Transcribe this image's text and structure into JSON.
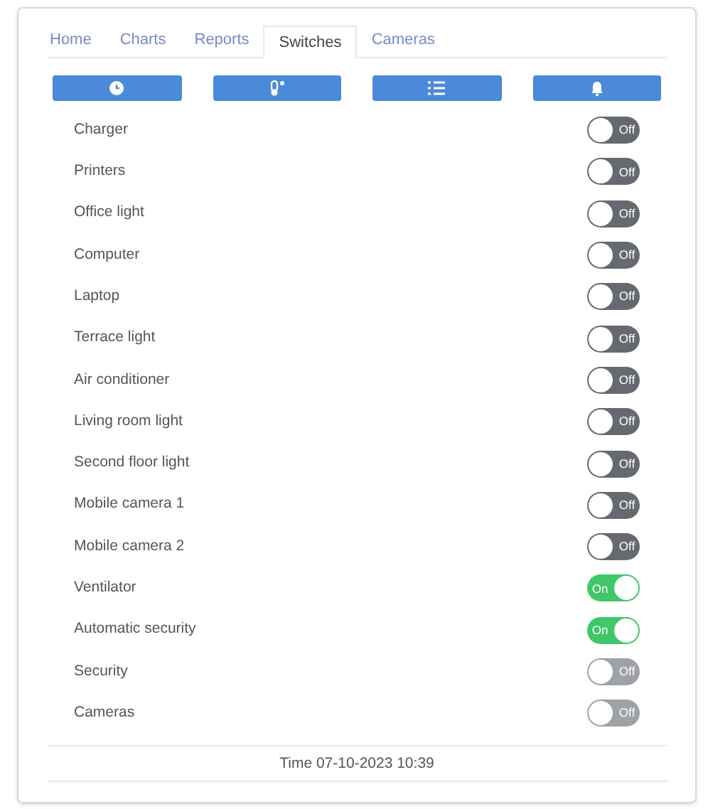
{
  "tabs": [
    {
      "label": "Home",
      "selected": false
    },
    {
      "label": "Charts",
      "selected": false
    },
    {
      "label": "Reports",
      "selected": false
    },
    {
      "label": "Switches",
      "selected": true
    },
    {
      "label": "Cameras",
      "selected": false
    }
  ],
  "toolbar": [
    {
      "kind": "clock"
    },
    {
      "kind": "thermometer"
    },
    {
      "kind": "list"
    },
    {
      "kind": "bell"
    }
  ],
  "switches": [
    {
      "name": "Charger",
      "on": false,
      "disabled": false,
      "state_label": "Off"
    },
    {
      "name": "Printers",
      "on": false,
      "disabled": false,
      "state_label": "Off"
    },
    {
      "name": "Office light",
      "on": false,
      "disabled": false,
      "state_label": "Off"
    },
    {
      "name": "Computer",
      "on": false,
      "disabled": false,
      "state_label": "Off"
    },
    {
      "name": "Laptop",
      "on": false,
      "disabled": false,
      "state_label": "Off"
    },
    {
      "name": "Terrace light",
      "on": false,
      "disabled": false,
      "state_label": "Off"
    },
    {
      "name": "Air conditioner",
      "on": false,
      "disabled": false,
      "state_label": "Off"
    },
    {
      "name": "Living room light",
      "on": false,
      "disabled": false,
      "state_label": "Off"
    },
    {
      "name": "Second floor light",
      "on": false,
      "disabled": false,
      "state_label": "Off"
    },
    {
      "name": "Mobile camera 1",
      "on": false,
      "disabled": false,
      "state_label": "Off"
    },
    {
      "name": "Mobile camera 2",
      "on": false,
      "disabled": false,
      "state_label": "Off"
    },
    {
      "name": "Ventilator",
      "on": true,
      "disabled": false,
      "state_label": "On"
    },
    {
      "name": "Automatic security",
      "on": true,
      "disabled": false,
      "state_label": "On"
    },
    {
      "name": "Security",
      "on": false,
      "disabled": true,
      "state_label": "Off"
    },
    {
      "name": "Cameras",
      "on": false,
      "disabled": true,
      "state_label": "Off"
    }
  ],
  "footer": {
    "time": "Time 07-10-2023 10:39"
  }
}
